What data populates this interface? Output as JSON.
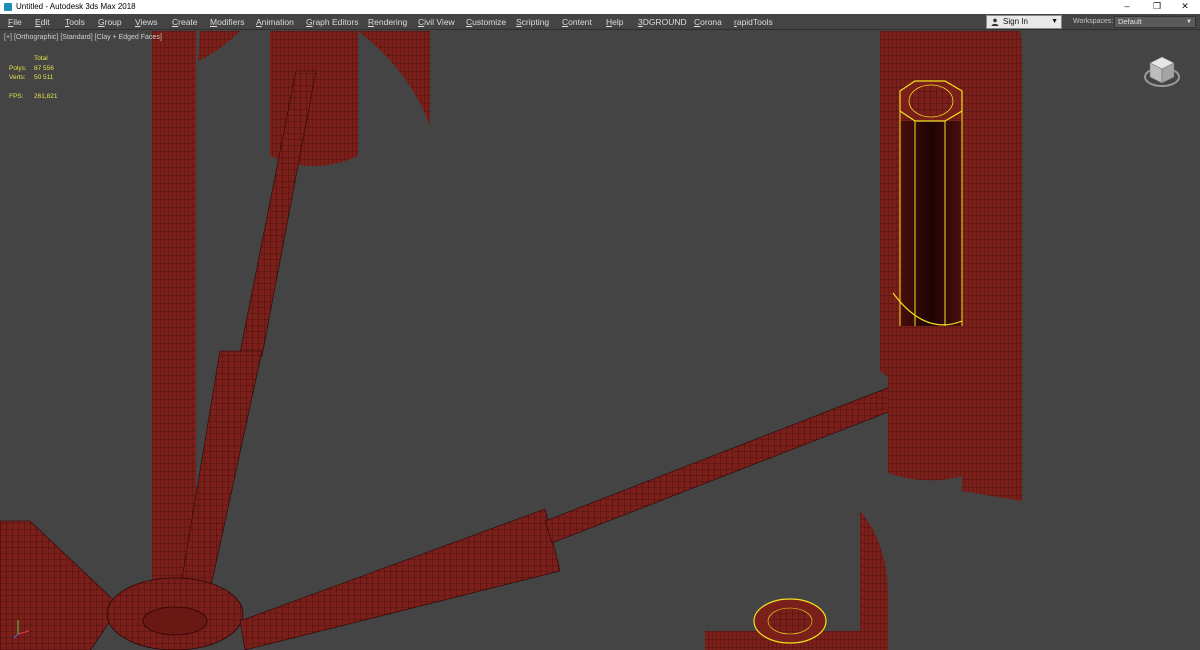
{
  "window": {
    "title": "Untitled - Autodesk 3ds Max 2018",
    "minimize": "–",
    "restore": "❐",
    "close": "✕"
  },
  "menu": {
    "items": [
      "File",
      "Edit",
      "Tools",
      "Group",
      "Views",
      "Create",
      "Modifiers",
      "Animation",
      "Graph Editors",
      "Rendering",
      "Civil View",
      "Customize",
      "Scripting",
      "Content",
      "Help",
      "3DGROUND",
      "Corona",
      "rapidTools"
    ],
    "sign_in": "Sign In",
    "workspaces_label": "Workspaces:",
    "workspace_value": "Default"
  },
  "viewport": {
    "labels": [
      "[+]",
      "[Orthographic]",
      "[Standard]",
      "[Clay + Edged Faces]"
    ],
    "stats": {
      "header": "Total",
      "polys_label": "Polys:",
      "polys_value": "87 556",
      "verts_label": "Verts:",
      "verts_value": "50 511",
      "fps_label": "FPS:",
      "fps_value": "261,821"
    }
  },
  "colors": {
    "viewport_bg": "#444444",
    "mesh_fill": "#7a1f1a",
    "mesh_wire": "#2a0605",
    "selection": "#f2e21d",
    "stats_text": "#e3e34a"
  },
  "icons": {
    "app": "3ds-max-logo-icon",
    "user": "user-icon",
    "viewcube": "viewcube-icon",
    "axis": "axis-tripod-icon"
  }
}
